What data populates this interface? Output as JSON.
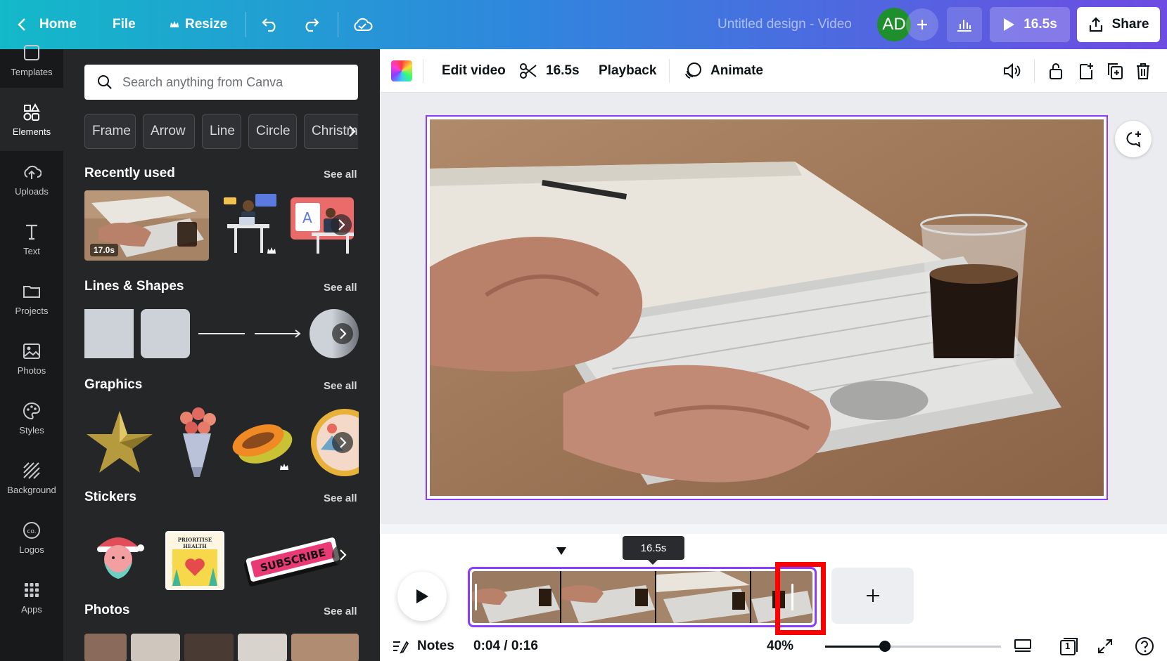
{
  "topbar": {
    "home": "Home",
    "file": "File",
    "resize": "Resize",
    "title": "Untitled design - Video",
    "avatar_initials": "AD",
    "play_duration": "16.5s",
    "share": "Share"
  },
  "rail": {
    "items": [
      {
        "label": "Templates",
        "icon": "templates-icon"
      },
      {
        "label": "Elements",
        "icon": "elements-icon"
      },
      {
        "label": "Uploads",
        "icon": "upload-cloud-icon"
      },
      {
        "label": "Text",
        "icon": "text-icon"
      },
      {
        "label": "Projects",
        "icon": "folder-icon"
      },
      {
        "label": "Photos",
        "icon": "image-icon"
      },
      {
        "label": "Styles",
        "icon": "palette-icon"
      },
      {
        "label": "Background",
        "icon": "background-hatch-icon"
      },
      {
        "label": "Logos",
        "icon": "logo-icon"
      },
      {
        "label": "Apps",
        "icon": "apps-grid-icon"
      }
    ],
    "active": "Elements"
  },
  "panel": {
    "search_placeholder": "Search anything from Canva",
    "chips": [
      "Frame",
      "Arrow",
      "Line",
      "Circle",
      "Christm"
    ],
    "see_all": "See all",
    "sections": {
      "recently_used": "Recently used",
      "lines_shapes": "Lines & Shapes",
      "graphics": "Graphics",
      "stickers": "Stickers",
      "photos": "Photos"
    },
    "recent_video_duration": "17.0s",
    "sticker_health_text": "PRIORITISE HEALTH",
    "sticker_subscribe_text": "SUBSCRIBE"
  },
  "toolbar": {
    "edit_video": "Edit video",
    "trim_duration": "16.5s",
    "playback": "Playback",
    "animate": "Animate"
  },
  "timeline": {
    "tooltip": "16.5s",
    "notes": "Notes",
    "time": "0:04 / 0:16",
    "zoom": "40%",
    "zoom_fraction": 0.34,
    "page_count": "1"
  },
  "colors": {
    "accent": "#8b3dff",
    "highlight": "#ff0000",
    "panel_bg": "#252627",
    "rail_bg": "#18191b"
  }
}
